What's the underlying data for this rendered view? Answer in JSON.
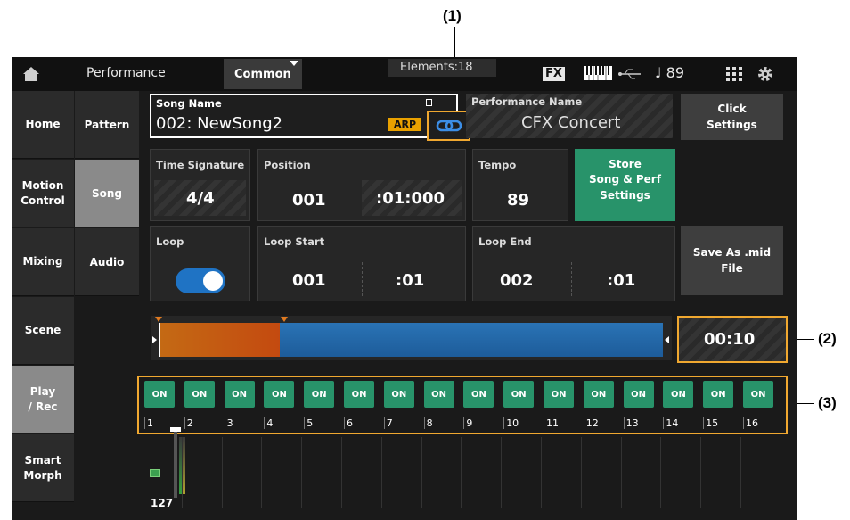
{
  "callouts": {
    "c1": "(1)",
    "c2": "(2)",
    "c3": "(3)"
  },
  "topbar": {
    "home_icon": "home-icon",
    "title": "Performance",
    "mode_select": "Common",
    "elements_label": "Elements:18",
    "fx_label": "FX",
    "keyboard_icon": "keyboard-icon",
    "usb_icon": "usb-icon",
    "tempo": "♩ 89",
    "grid_icon": "grid-icon",
    "gear_icon": "gear-icon"
  },
  "nav_primary": [
    "Home",
    "Motion\nControl",
    "Mixing",
    "Scene",
    "Play\n/ Rec",
    "Smart\nMorph"
  ],
  "nav_secondary": [
    "Pattern",
    "Song",
    "Audio"
  ],
  "song": {
    "label": "Song Name",
    "value": "002: NewSong2",
    "arp": "ARP",
    "link_icon": "link-icon"
  },
  "performance": {
    "label": "Performance Name",
    "value": "CFX Concert"
  },
  "click_settings": "Click\nSettings",
  "time_signature": {
    "label": "Time Signature",
    "value": "4/4"
  },
  "position": {
    "label": "Position",
    "measure": "001",
    "beat_tick": ":01:000"
  },
  "tempo": {
    "label": "Tempo",
    "value": "89"
  },
  "store_button": "Store\nSong & Perf\nSettings",
  "loop": {
    "label": "Loop",
    "on": true
  },
  "loop_start": {
    "label": "Loop Start",
    "measure": "001",
    "beat": ":01"
  },
  "loop_end": {
    "label": "Loop End",
    "measure": "002",
    "beat": ":01"
  },
  "save_midi": "Save As .mid\nFile",
  "timeline": {
    "progress": 0.24,
    "time": "00:10"
  },
  "tracks": {
    "labels": [
      "ON",
      "ON",
      "ON",
      "ON",
      "ON",
      "ON",
      "ON",
      "ON",
      "ON",
      "ON",
      "ON",
      "ON",
      "ON",
      "ON",
      "ON",
      "ON"
    ],
    "numbers": [
      "1",
      "2",
      "3",
      "4",
      "5",
      "6",
      "7",
      "8",
      "9",
      "10",
      "11",
      "12",
      "13",
      "14",
      "15",
      "16"
    ]
  },
  "meter": {
    "value": "127"
  },
  "colors": {
    "accent_green": "#28936a",
    "toggle_blue": "#1f73c4",
    "callout_orange": "#f0a830",
    "arp_yellow": "#e9a100"
  }
}
